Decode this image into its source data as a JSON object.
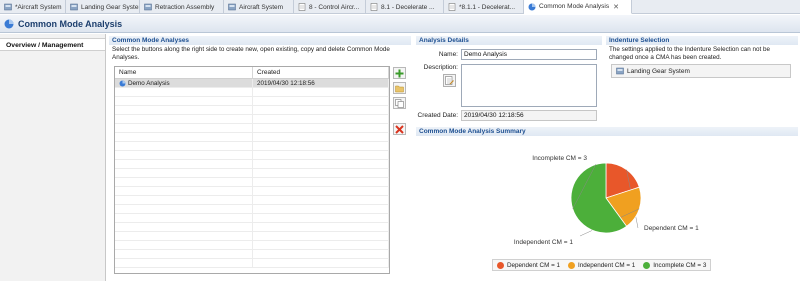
{
  "tabs": [
    {
      "label": "*Aircraft System",
      "icon": "system-icon",
      "active": false
    },
    {
      "label": "Landing Gear System",
      "icon": "system-icon",
      "active": false
    },
    {
      "label": "Retraction Assembly",
      "icon": "system-icon",
      "active": false
    },
    {
      "label": "Aircraft System",
      "icon": "system-icon",
      "active": false
    },
    {
      "label": "8 - Control Aircr...",
      "icon": "document-icon",
      "active": false
    },
    {
      "label": "8.1 - Decelerate ...",
      "icon": "document-icon",
      "active": false
    },
    {
      "label": "*8.1.1 - Decelerat...",
      "icon": "document-icon",
      "active": false
    },
    {
      "label": "Common Mode Analysis",
      "icon": "cma-icon",
      "active": true,
      "close": "✕"
    }
  ],
  "page_title": "Common Mode Analysis",
  "nav": {
    "overview": "Overview / Management"
  },
  "analyses": {
    "heading": "Common Mode Analyses",
    "description": "Select the buttons along the right side to create new, open existing, copy and delete Common Mode Analyses.",
    "columns": [
      "Name",
      "Created"
    ],
    "rows": [
      {
        "name": "Demo Analysis",
        "created": "2019/04/30 12:18:56",
        "selected": true
      }
    ],
    "buttons": [
      "add-icon",
      "open-folder-icon",
      "copy-icon",
      "delete-icon"
    ]
  },
  "details": {
    "heading": "Analysis Details",
    "name_label": "Name:",
    "name_value": "Demo Analysis",
    "description_label": "Description:",
    "description_value": "",
    "created_label": "Created Date:",
    "created_value": "2019/04/30 12:18:56"
  },
  "indenture": {
    "heading": "Indenture Selection",
    "description": "The settings applied to the Indenture Selection can not be changed once a CMA has been created.",
    "selected": "Landing Gear System"
  },
  "colors": {
    "dependent": "#e8572a",
    "independent": "#f0a020",
    "incomplete": "#4caf3a",
    "heading_text": "#1d4f91"
  },
  "chart_data": {
    "type": "pie",
    "title": "Common Mode Analysis Summary",
    "categories": [
      "Dependent CM = 1",
      "Independent CM = 1",
      "Incomplete CM = 3"
    ],
    "values": [
      1,
      1,
      3
    ],
    "legend": "bottom"
  }
}
